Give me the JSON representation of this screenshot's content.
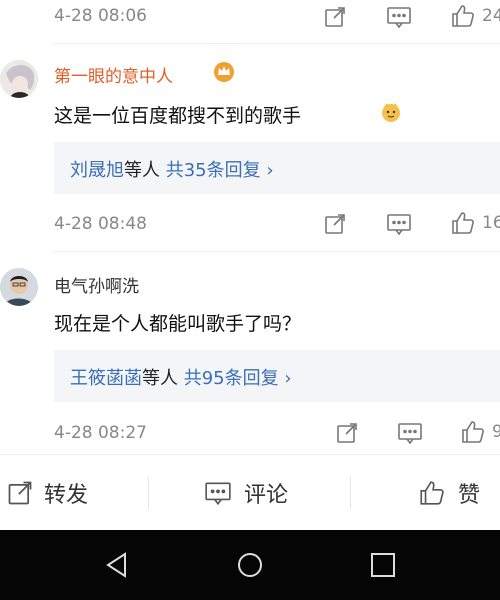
{
  "comments": [
    {
      "time": "4-28 08:06",
      "likes": "24"
    },
    {
      "username": "第一眼的意中人",
      "text": "这是一位百度都搜不到的歌手",
      "reply_users": "刘晟旭",
      "reply_mid": "等人",
      "reply_count": "共35条回复",
      "reply_chevron": "›",
      "time": "4-28 08:48",
      "likes": "16",
      "username_color": "#e0602a"
    },
    {
      "username": "电气孙啊洗",
      "text": "现在是个人都能叫歌手了吗？",
      "reply_users": "王筱菡菡",
      "reply_mid": "等人",
      "reply_count": "共95条回复",
      "reply_chevron": "›",
      "time": "4-28 08:27",
      "likes": "9"
    }
  ],
  "bottom_bar": {
    "repost": "转发",
    "comment": "评论",
    "like": "赞"
  },
  "colors": {
    "link_blue": "#3b6fb6",
    "accent_orange": "#e0602a"
  },
  "icons": [
    "share-icon",
    "comment-icon",
    "thumbs-up-icon",
    "crown-icon",
    "emoji-icon",
    "back-icon",
    "home-icon",
    "recents-icon"
  ]
}
